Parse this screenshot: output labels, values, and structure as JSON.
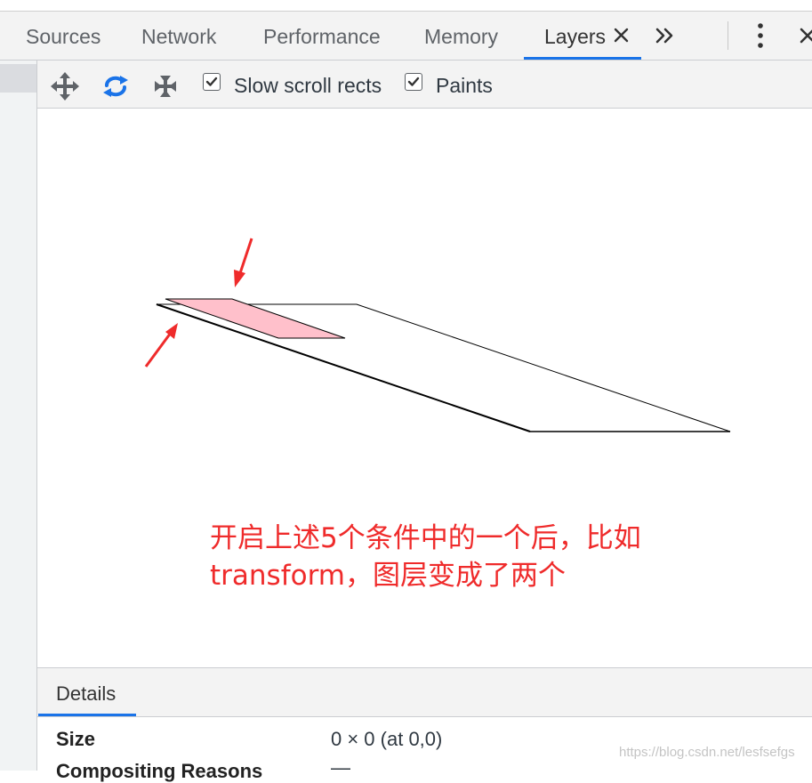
{
  "tabs": [
    {
      "label": "Sources"
    },
    {
      "label": "Network"
    },
    {
      "label": "Performance"
    },
    {
      "label": "Memory"
    },
    {
      "label": "Layers",
      "active": true
    }
  ],
  "toolbar": {
    "pan_tool": "pan-mode-icon",
    "rotate_tool": "rotate-mode-icon",
    "reset_tool": "reset-transform-icon",
    "slow_scroll_rects": {
      "label": "Slow scroll rects",
      "checked": true
    },
    "paints": {
      "label": "Paints",
      "checked": true
    }
  },
  "annotation": {
    "line1": "开启上述5个条件中的一个后，比如",
    "line2": "transform，图层变成了两个"
  },
  "details": {
    "tab_label": "Details",
    "rows": [
      {
        "key": "Size",
        "value": "0 × 0 (at 0,0)"
      },
      {
        "key": "Compositing Reasons",
        "value": "—"
      }
    ]
  },
  "watermark": "https://blog.csdn.net/lesfsefgs",
  "colors": {
    "accent": "#1a73e8",
    "annotation_red": "#ef2b2b",
    "layer_highlight": "#ffc0cb"
  }
}
